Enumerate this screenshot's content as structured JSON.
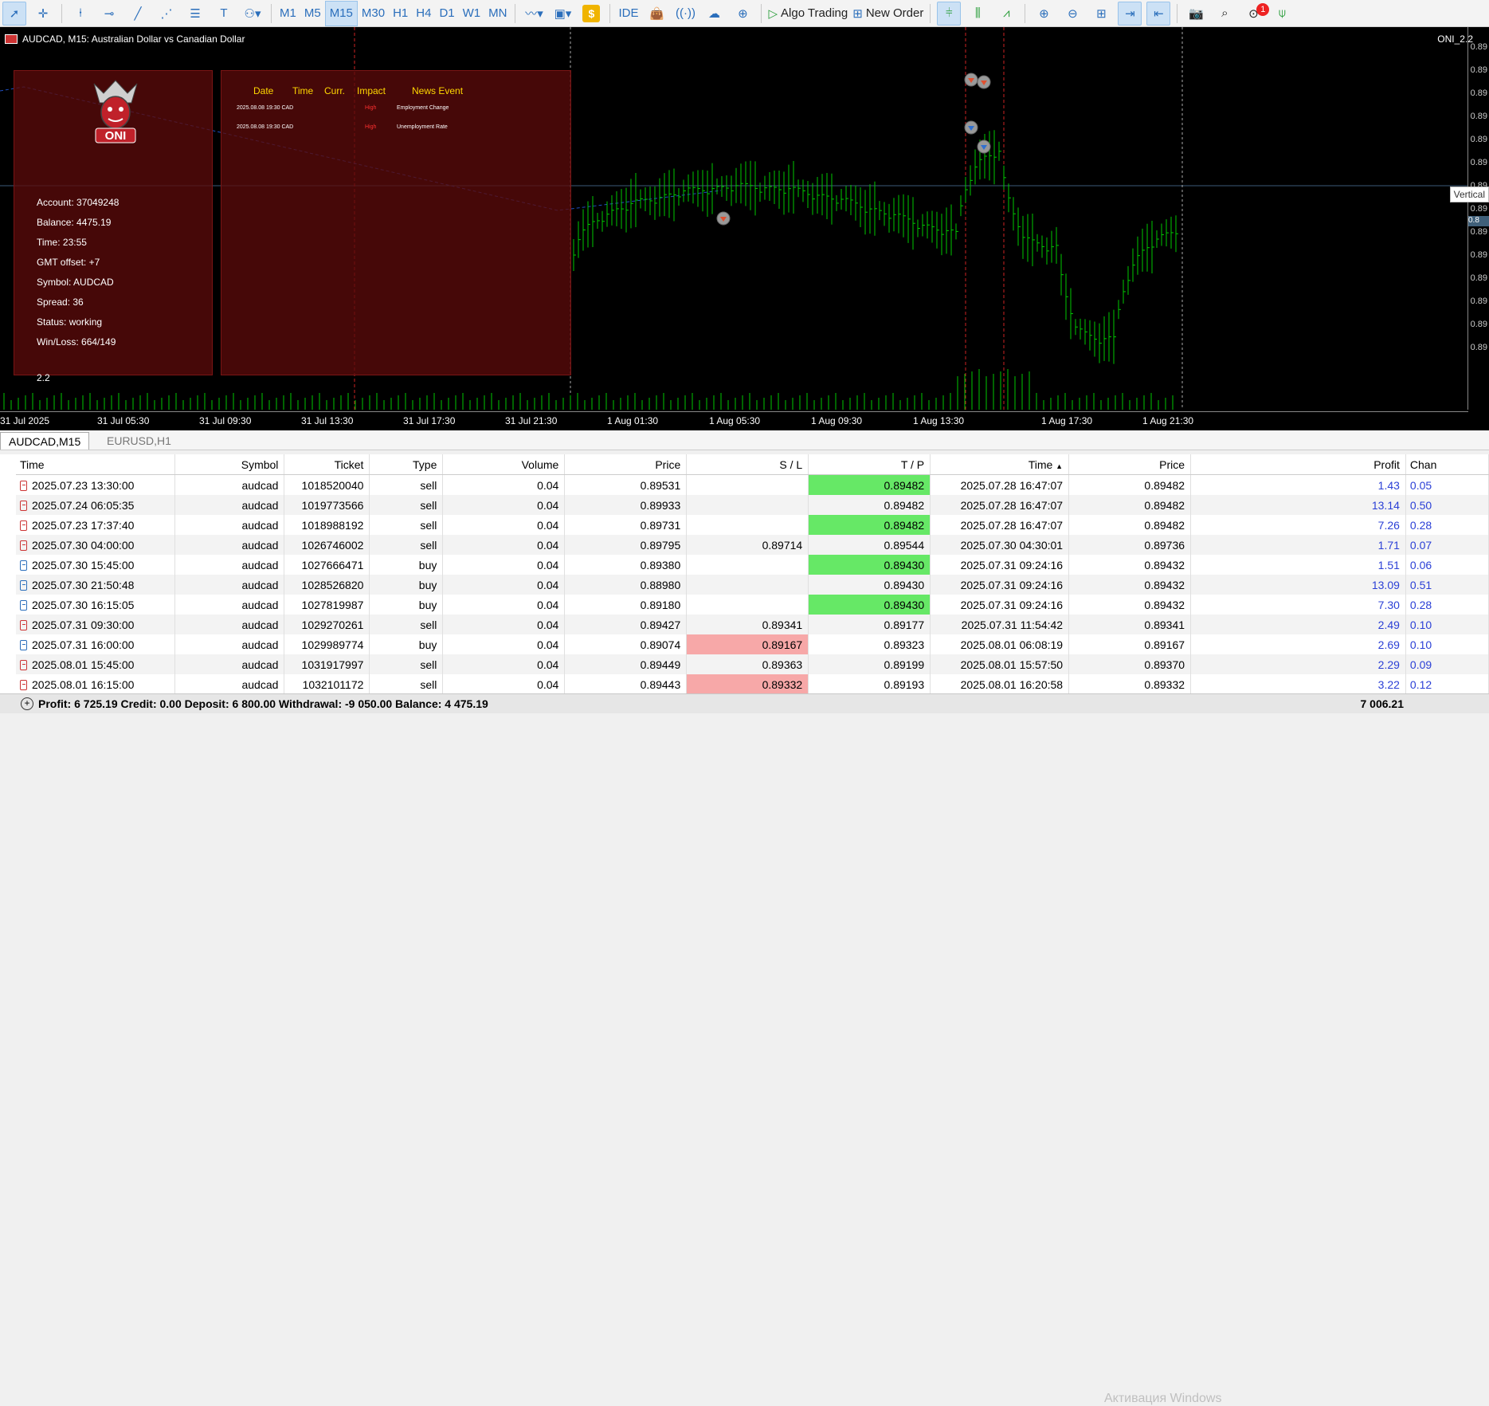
{
  "toolbar": {
    "timeframes": [
      "M1",
      "M5",
      "M15",
      "M30",
      "H1",
      "H4",
      "D1",
      "W1",
      "MN"
    ],
    "active_timeframe": "M15",
    "ide_label": "IDE",
    "algo_trading_label": "Algo Trading",
    "new_order_label": "New Order",
    "notifications_count": "1"
  },
  "chart": {
    "title": "AUDCAD, M15:  Australian Dollar vs Canadian Dollar",
    "indicator": "ONI_2.2",
    "price_labels": [
      "0.89",
      "0.89",
      "0.89",
      "0.89",
      "0.89",
      "0.89",
      "0.89",
      "0.89",
      "0.89",
      "0.89",
      "0.89",
      "0.89",
      "0.89",
      "0.89"
    ],
    "vertical_tooltip": "Vertical",
    "current_price_label": "0.8",
    "time_labels": [
      "31 Jul 2025",
      "31 Jul 05:30",
      "31 Jul 09:30",
      "31 Jul 13:30",
      "31 Jul 17:30",
      "31 Jul 21:30",
      "1 Aug 01:30",
      "1 Aug 05:30",
      "1 Aug 09:30",
      "1 Aug 13:30",
      "1 Aug 17:30",
      "1 Aug 21:30"
    ]
  },
  "info_panel": {
    "logo_text": "ONI",
    "lines": [
      "Account: 37049248",
      "Balance: 4475.19",
      "Time: 23:55",
      "GMT offset: +7",
      "Symbol: AUDCAD",
      "Spread: 36",
      "Status: working",
      "Win/Loss: 664/149"
    ],
    "version": "2.2"
  },
  "news_panel": {
    "headers": [
      "Date",
      "Time",
      "Curr.",
      "Impact",
      "News Event"
    ],
    "rows": [
      {
        "datetime": "2025.08.08 19:30 CAD",
        "impact": "High",
        "event": "Employment Change"
      },
      {
        "datetime": "2025.08.08 19:30 CAD",
        "impact": "High",
        "event": "Unemployment Rate"
      }
    ]
  },
  "chart_tabs": [
    "AUDCAD,M15",
    "EURUSD,H1"
  ],
  "table": {
    "headers": [
      "Time",
      "Symbol",
      "Ticket",
      "Type",
      "Volume",
      "Price",
      "S / L",
      "T / P",
      "Time",
      "Price",
      "Profit",
      "Chan"
    ],
    "rows": [
      [
        "2025.07.23 13:30:00",
        "audcad",
        "1018520040",
        "sell",
        "0.04",
        "0.89531",
        "",
        "0.89482",
        "2025.07.28 16:47:07",
        "0.89482",
        "1.43",
        "0.05"
      ],
      [
        "2025.07.24 06:05:35",
        "audcad",
        "1019773566",
        "sell",
        "0.04",
        "0.89933",
        "",
        "0.89482",
        "2025.07.28 16:47:07",
        "0.89482",
        "13.14",
        "0.50"
      ],
      [
        "2025.07.23 17:37:40",
        "audcad",
        "1018988192",
        "sell",
        "0.04",
        "0.89731",
        "",
        "0.89482",
        "2025.07.28 16:47:07",
        "0.89482",
        "7.26",
        "0.28"
      ],
      [
        "2025.07.30 04:00:00",
        "audcad",
        "1026746002",
        "sell",
        "0.04",
        "0.89795",
        "0.89714",
        "0.89544",
        "2025.07.30 04:30:01",
        "0.89736",
        "1.71",
        "0.07"
      ],
      [
        "2025.07.30 15:45:00",
        "audcad",
        "1027666471",
        "buy",
        "0.04",
        "0.89380",
        "",
        "0.89430",
        "2025.07.31 09:24:16",
        "0.89432",
        "1.51",
        "0.06"
      ],
      [
        "2025.07.30 21:50:48",
        "audcad",
        "1028526820",
        "buy",
        "0.04",
        "0.88980",
        "",
        "0.89430",
        "2025.07.31 09:24:16",
        "0.89432",
        "13.09",
        "0.51"
      ],
      [
        "2025.07.30 16:15:05",
        "audcad",
        "1027819987",
        "buy",
        "0.04",
        "0.89180",
        "",
        "0.89430",
        "2025.07.31 09:24:16",
        "0.89432",
        "7.30",
        "0.28"
      ],
      [
        "2025.07.31 09:30:00",
        "audcad",
        "1029270261",
        "sell",
        "0.04",
        "0.89427",
        "0.89341",
        "0.89177",
        "2025.07.31 11:54:42",
        "0.89341",
        "2.49",
        "0.10"
      ],
      [
        "2025.07.31 16:00:00",
        "audcad",
        "1029989774",
        "buy",
        "0.04",
        "0.89074",
        "0.89167",
        "0.89323",
        "2025.08.01 06:08:19",
        "0.89167",
        "2.69",
        "0.10"
      ],
      [
        "2025.08.01 15:45:00",
        "audcad",
        "1031917997",
        "sell",
        "0.04",
        "0.89449",
        "0.89363",
        "0.89199",
        "2025.08.01 15:57:50",
        "0.89370",
        "2.29",
        "0.09"
      ],
      [
        "2025.08.01 16:15:00",
        "audcad",
        "1032101172",
        "sell",
        "0.04",
        "0.89443",
        "0.89332",
        "0.89193",
        "2025.08.01 16:20:58",
        "0.89332",
        "3.22",
        "0.12"
      ]
    ]
  },
  "footer": {
    "summary": "Profit: 6 725.19  Credit: 0.00  Deposit: 6 800.00  Withdrawal: -9 050.00  Balance: 4 475.19",
    "total_profit": "7 006.21",
    "watermark": "Активация Windows"
  },
  "colors": {
    "candle": "#00c800",
    "tp_cell": "#66e866",
    "sl_cell": "#f7a8a8",
    "profit_text": "#2a3fd6"
  }
}
